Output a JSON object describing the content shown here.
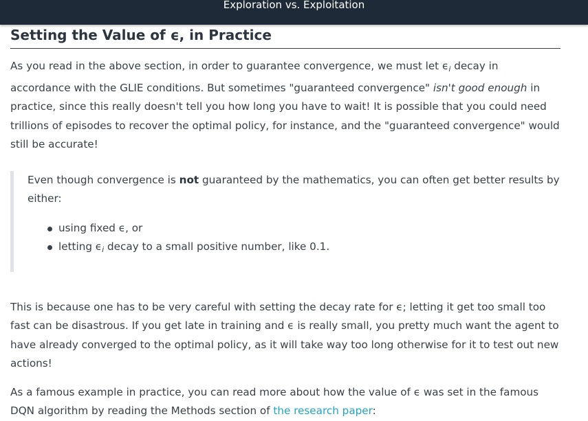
{
  "header": {
    "title": "Exploration vs. Exploitation"
  },
  "section": {
    "heading": "Setting the Value of ϵ, in Practice"
  },
  "para1": {
    "t1": "As you read in the above section, in order to guarantee convergence, we must let ",
    "eps": "ϵ",
    "eps_sub": "i",
    "t2": " decay in accordance with the GLIE conditions. But sometimes \"guaranteed convergence\" ",
    "italic": "isn't good enough",
    "t3": " in practice, since this really doesn't tell you how long you have to wait! It is possible that you could need trillions of episodes to recover the optimal policy, for instance, and the \"guaranteed convergence\" would still be accurate!"
  },
  "callout": {
    "t1": "Even though convergence is ",
    "bold": "not",
    "t2": " guaranteed by the mathematics, you can often get better results by either:",
    "bullet1": "using fixed ϵ, or",
    "bullet2_pre": "letting ",
    "bullet2_eps": "ϵ",
    "bullet2_sub": "i",
    "bullet2_post": " decay to a small positive number, like 0.1."
  },
  "para3": {
    "text": "This is because one has to be very careful with setting the decay rate for ϵ; letting it get too small too fast can be disastrous. If you get late in training and ϵ is really small, you pretty much want the agent to have already converged to the optimal policy, as it will take way too long otherwise for it to test out new actions!"
  },
  "para4": {
    "t1": "As a famous example in practice, you can read more about how the value of ϵ was set in the famous DQN algorithm by reading the Methods section of ",
    "link": "the research paper",
    "t2": ":"
  }
}
